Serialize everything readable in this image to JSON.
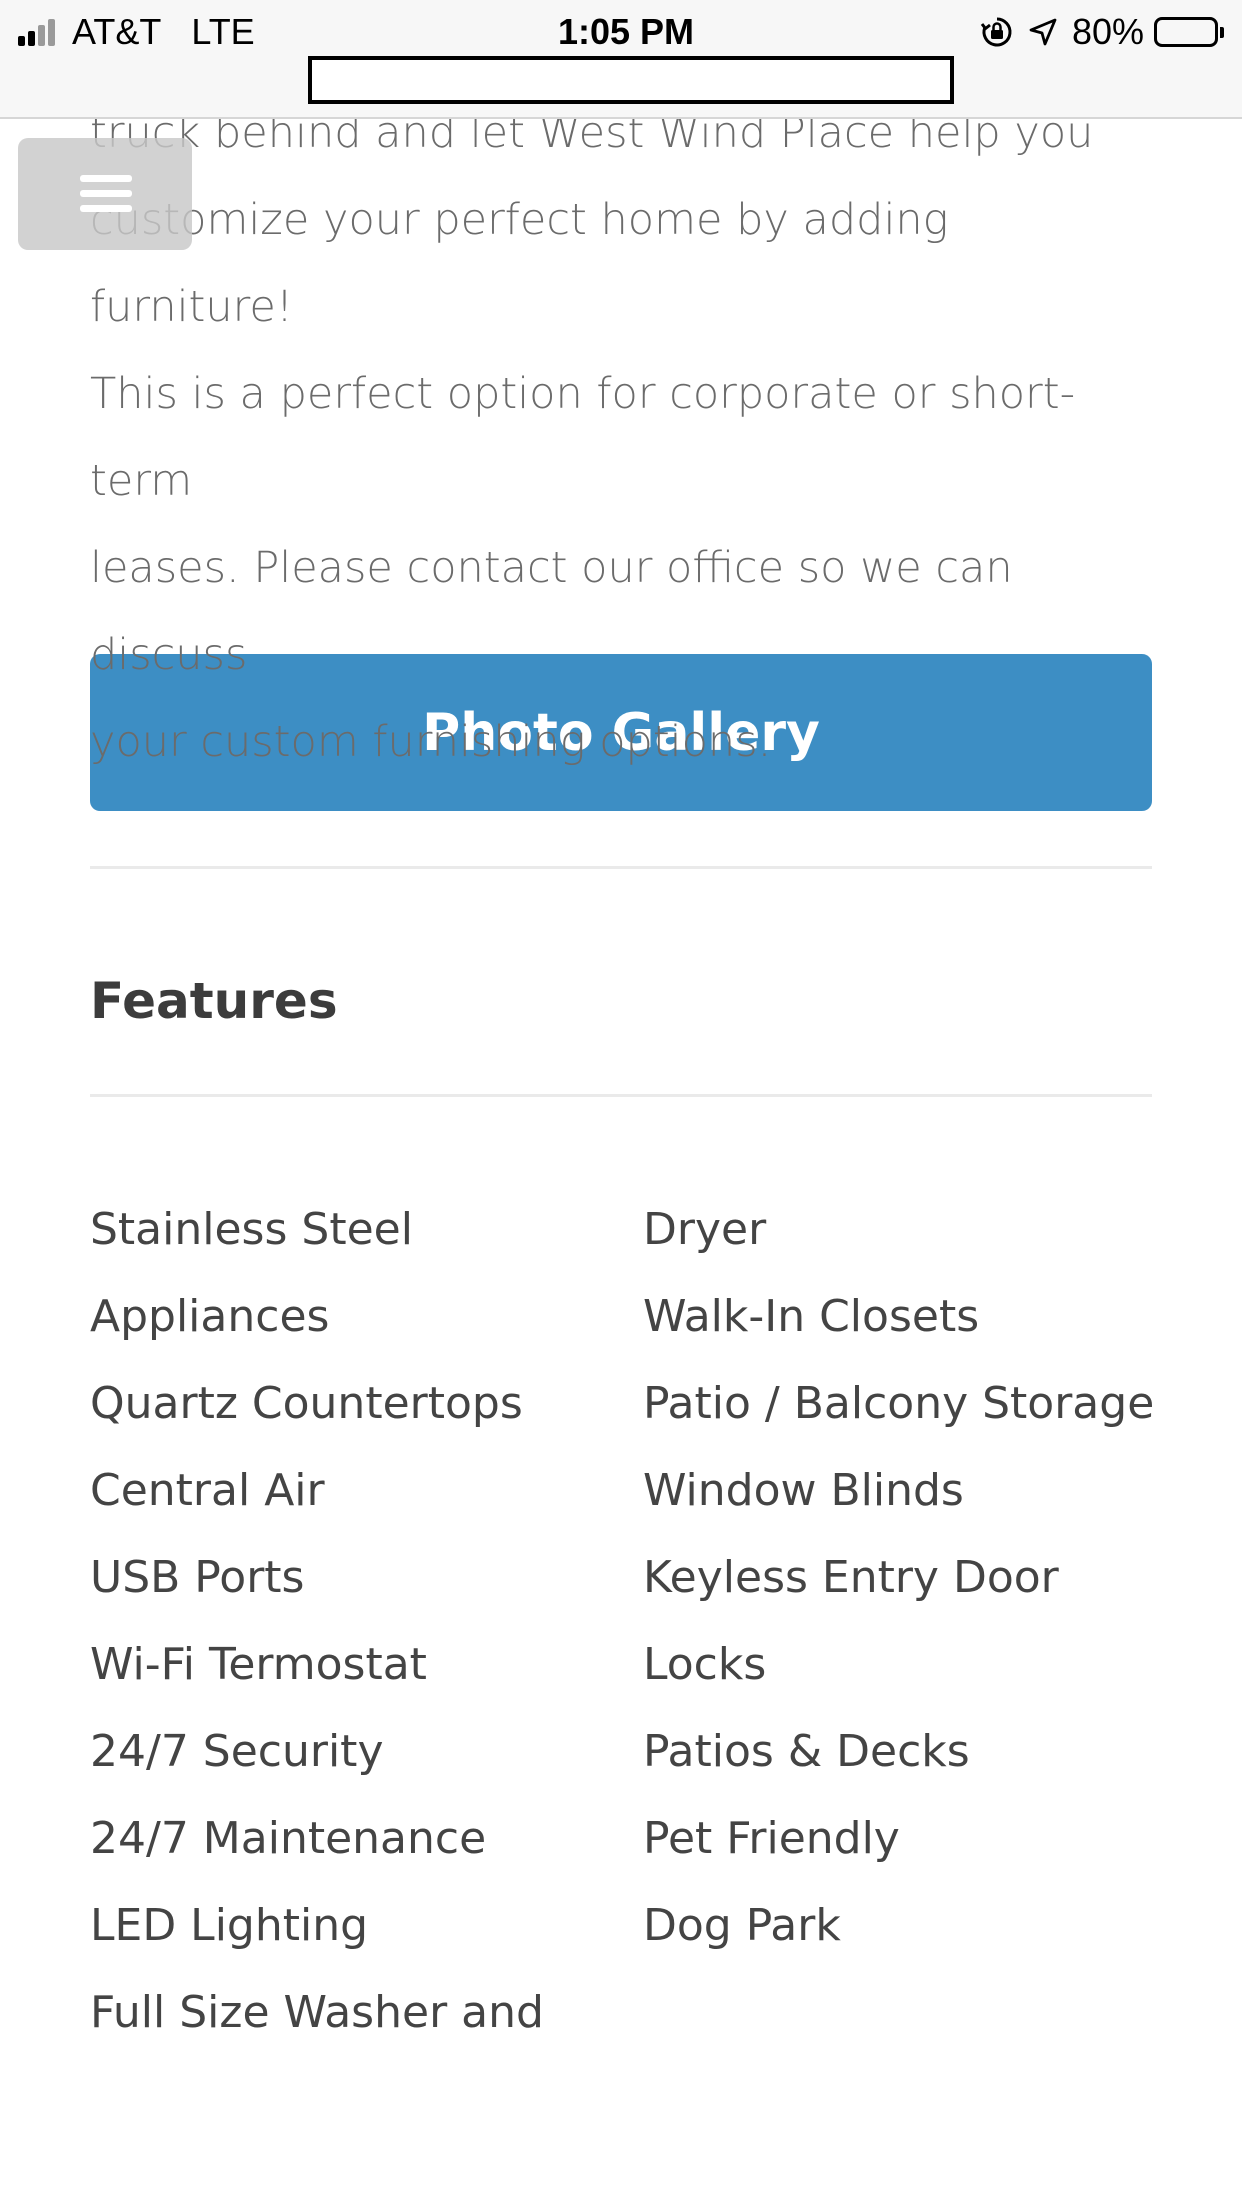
{
  "status_bar": {
    "carrier": "AT&T",
    "network": "LTE",
    "time": "1:05 PM",
    "battery_percent": "80%",
    "battery_level": 0.8,
    "icons": [
      "signal-bars-icon",
      "orientation-lock-icon",
      "location-arrow-icon",
      "battery-icon"
    ]
  },
  "menu": {
    "icon": "hamburger-menu-icon"
  },
  "content": {
    "intro_text": "truck behind and let West Wind Place help you\ncustomize your perfect home by adding furniture!\nThis is a perfect option for corporate or short-term\nleases. Please contact our office so we can discuss\nyour custom furnishing options.",
    "gallery_button_label": "Photo Gallery",
    "features_heading": "Features",
    "features_left": [
      "Stainless Steel",
      "Appliances",
      "Quartz Countertops",
      "Central Air",
      "USB Ports",
      "Wi-Fi Termostat",
      "24/7 Security",
      "24/7 Maintenance",
      "LED Lighting",
      "Full Size Washer and"
    ],
    "features_right": [
      "Dryer",
      "Walk-In Closets",
      "Patio / Balcony Storage",
      "Window Blinds",
      "Keyless Entry Door",
      "Locks",
      "Patios & Decks",
      "Pet Friendly",
      "Dog Park"
    ]
  },
  "colors": {
    "button_blue": "#3d8ec4",
    "heading_text": "#3c3c3c",
    "body_text": "#6b6b6b",
    "feature_text": "#444444",
    "divider": "#eaeaea"
  }
}
